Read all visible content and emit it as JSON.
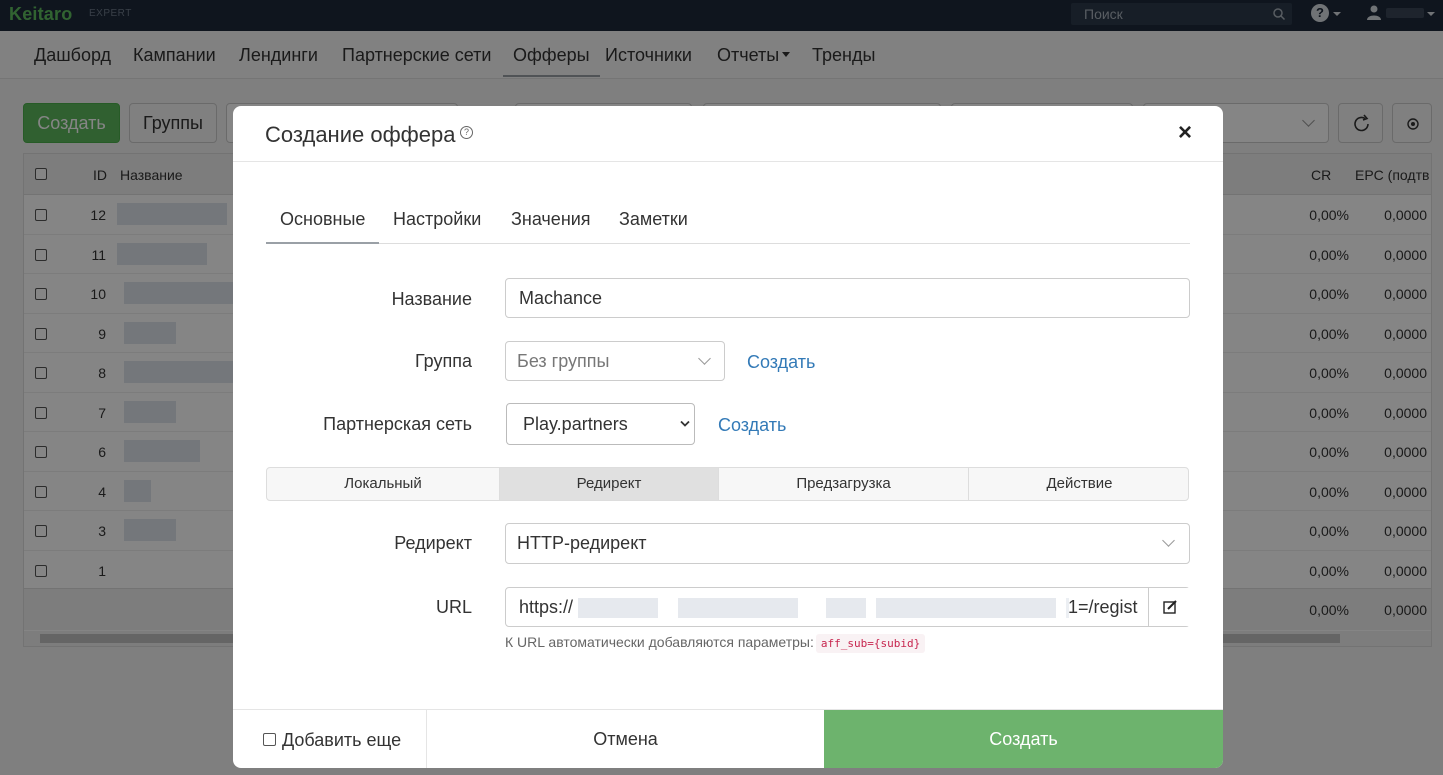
{
  "app": {
    "logo": "Keitaro",
    "logo_sub": "EXPERT"
  },
  "topbar": {
    "search_placeholder": "Поиск",
    "help_label": "?"
  },
  "nav": {
    "items": [
      {
        "label": "Дашборд"
      },
      {
        "label": "Кампании"
      },
      {
        "label": "Лендинги"
      },
      {
        "label": "Партнерские сети"
      },
      {
        "label": "Офферы"
      },
      {
        "label": "Источники"
      },
      {
        "label": "Отчеты"
      },
      {
        "label": "Тренды"
      }
    ],
    "active": "Офферы"
  },
  "page": {
    "create_label": "Создать",
    "groups_label": "Группы",
    "table": {
      "headers": {
        "id": "ID",
        "name": "Название",
        "cr": "CR",
        "epc": "EPC (подтв"
      },
      "rows": [
        {
          "id": "12",
          "cr": "0,00%",
          "epc": "0,0000"
        },
        {
          "id": "11",
          "cr": "0,00%",
          "epc": "0,0000"
        },
        {
          "id": "10",
          "cr": "0,00%",
          "epc": "0,0000"
        },
        {
          "id": "9",
          "cr": "0,00%",
          "epc": "0,0000"
        },
        {
          "id": "8",
          "cr": "0,00%",
          "epc": "0,0000"
        },
        {
          "id": "7",
          "cr": "0,00%",
          "epc": "0,0000"
        },
        {
          "id": "6",
          "cr": "0,00%",
          "epc": "0,0000"
        },
        {
          "id": "4",
          "cr": "0,00%",
          "epc": "0,0000"
        },
        {
          "id": "3",
          "cr": "0,00%",
          "epc": "0,0000"
        },
        {
          "id": "1",
          "cr": "0,00%",
          "epc": "0,0000"
        }
      ],
      "footer": {
        "cr": "0,00%",
        "epc": "0,0000"
      }
    }
  },
  "modal": {
    "title": "Создание оффера",
    "help_label": "?",
    "close_label": "×",
    "tabs": [
      {
        "label": "Основные"
      },
      {
        "label": "Настройки"
      },
      {
        "label": "Значения"
      },
      {
        "label": "Заметки"
      }
    ],
    "fields": {
      "name": {
        "label": "Название",
        "value": "Machance"
      },
      "group": {
        "label": "Группа",
        "value": "Без группы",
        "create_link": "Создать"
      },
      "network": {
        "label": "Партнерская сеть",
        "value": "Play.partners",
        "create_link": "Создать"
      },
      "redirect": {
        "label": "Редирект",
        "value": "HTTP-редирект"
      },
      "url": {
        "label": "URL",
        "value_start": "https://",
        "value_end": "1=/regist",
        "hint": "К URL автоматически добавляются параметры:",
        "hint_code": "aff_sub={subid}"
      }
    },
    "type_tabs": [
      {
        "label": "Локальный"
      },
      {
        "label": "Редирект"
      },
      {
        "label": "Предзагрузка"
      },
      {
        "label": "Действие"
      }
    ],
    "footer": {
      "add_more": "Добавить еще",
      "cancel": "Отмена",
      "submit": "Создать"
    }
  },
  "colors": {
    "accent_green": "#5cb85c",
    "link_blue": "#337ab7",
    "topbar": "#1e2a3a"
  }
}
